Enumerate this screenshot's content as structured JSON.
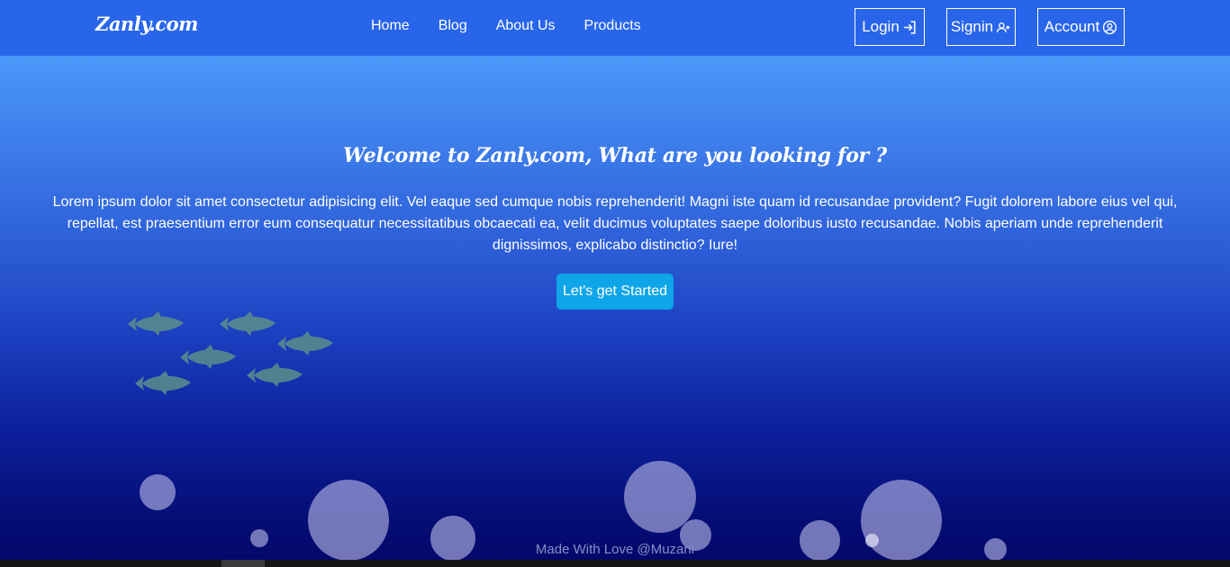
{
  "navbar": {
    "brand": "Zanly.com",
    "links": [
      "Home",
      "Blog",
      "About Us",
      "Products"
    ],
    "buttons": {
      "login": "Login",
      "signin": "Signin",
      "account": "Account"
    }
  },
  "hero": {
    "title": "Welcome to Zanly.com, What are you looking for ?",
    "text": "Lorem ipsum dolor sit amet consectetur adipisicing elit. Vel eaque sed cumque nobis reprehenderit! Magni iste quam id recusandae provident? Fugit dolorem labore eius vel qui, repellat, est praesentium error eum consequatur necessitatibus obcaecati ea, velit ducimus voluptates saepe doloribus iusto recusandae. Nobis aperiam unde reprehenderit dignissimos, explicabo distinctio? Iure!",
    "cta_label": "Let's get Started"
  },
  "footer": {
    "text": "Made With Love @Muzani"
  },
  "colors": {
    "navbar_bg": "#2865ea",
    "cta_bg": "#0ea5e9",
    "fish": "#5b8f8a"
  },
  "icons": [
    "login-icon",
    "user-plus-icon",
    "user-circle-icon",
    "fish-icon",
    "bubble-icon"
  ]
}
